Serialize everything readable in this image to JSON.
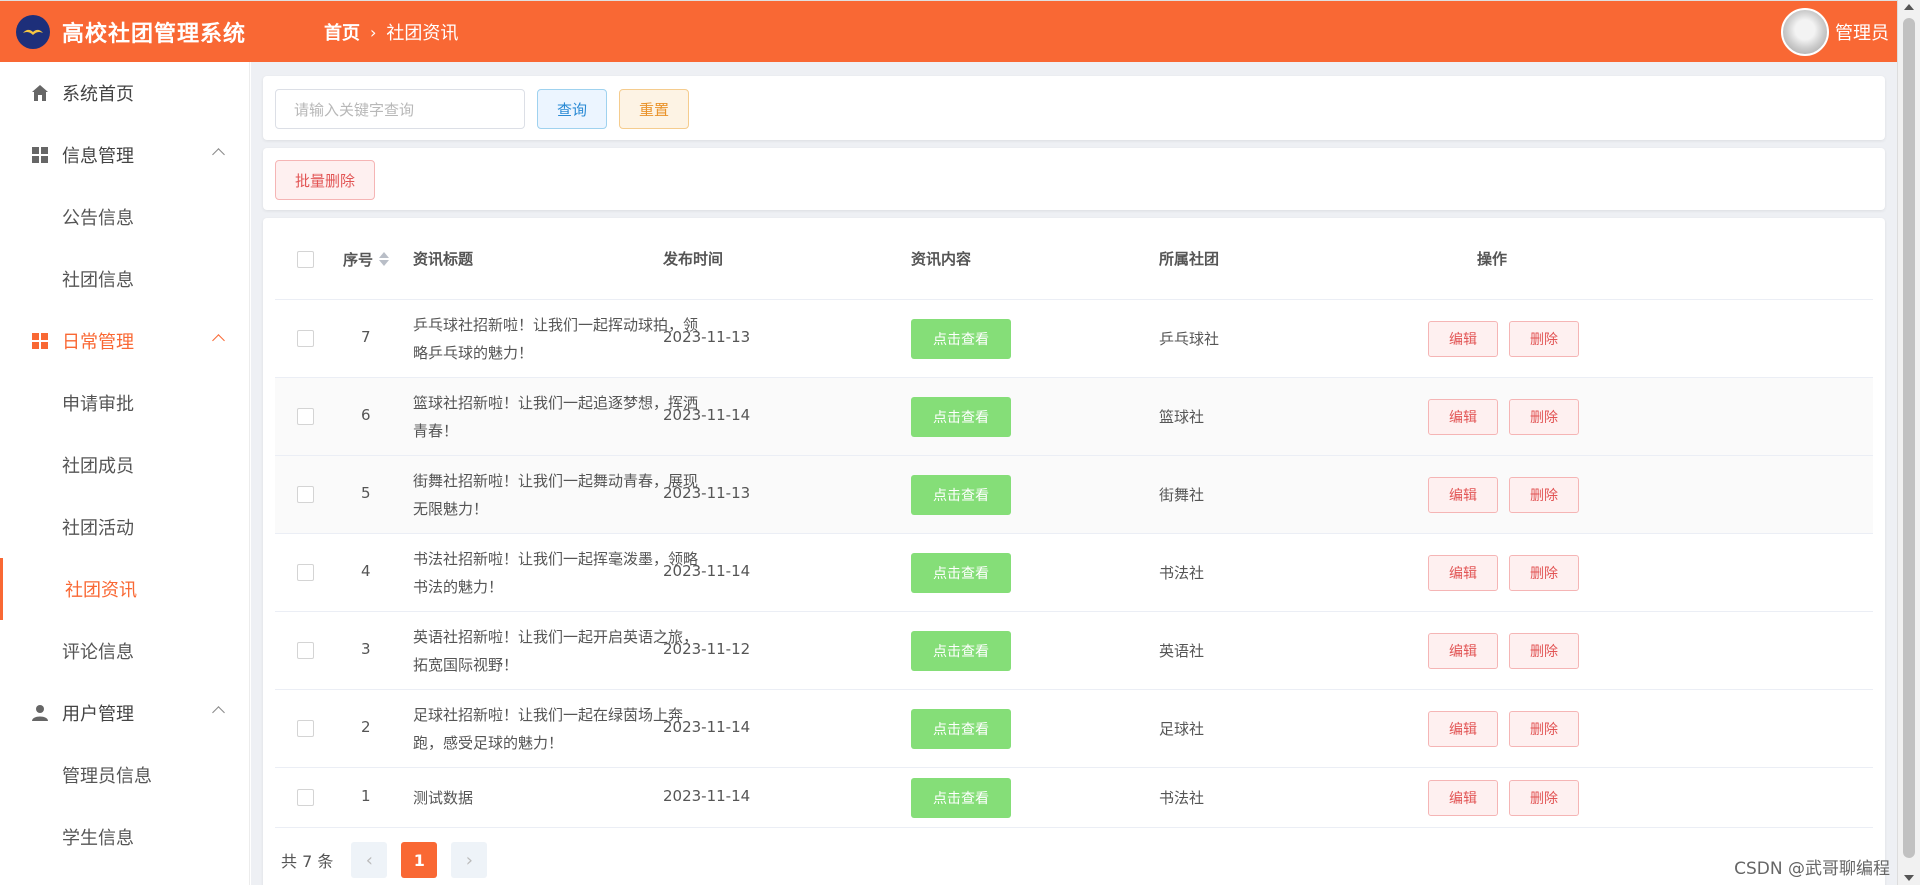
{
  "app": {
    "title": "高校社团管理系统",
    "user": "管理员"
  },
  "breadcrumb": {
    "home": "首页",
    "current": "社团资讯"
  },
  "sidebar": {
    "home": "系统首页",
    "info_group": "信息管理",
    "info_items": [
      "公告信息",
      "社团信息"
    ],
    "daily_group": "日常管理",
    "daily_items": [
      "申请审批",
      "社团成员",
      "社团活动",
      "社团资讯",
      "评论信息"
    ],
    "user_group": "用户管理",
    "user_items": [
      "管理员信息",
      "学生信息"
    ]
  },
  "search": {
    "placeholder": "请输入关键字查询",
    "query_label": "查询",
    "reset_label": "重置"
  },
  "toolbar": {
    "batch_delete_label": "批量删除"
  },
  "table": {
    "headers": {
      "index": "序号",
      "title": "资讯标题",
      "time": "发布时间",
      "content": "资讯内容",
      "club": "所属社团",
      "action": "操作"
    },
    "view_label": "点击查看",
    "edit_label": "编辑",
    "delete_label": "删除",
    "rows": [
      {
        "id": "7",
        "title": "乒乓球社招新啦！让我们一起挥动球拍，领略乒乓球的魅力！",
        "time": "2023-11-13",
        "club": "乒乓球社"
      },
      {
        "id": "6",
        "title": "篮球社招新啦！让我们一起追逐梦想，挥洒青春！",
        "time": "2023-11-14",
        "club": "篮球社"
      },
      {
        "id": "5",
        "title": "街舞社招新啦！让我们一起舞动青春，展现无限魅力！",
        "time": "2023-11-13",
        "club": "街舞社"
      },
      {
        "id": "4",
        "title": "书法社招新啦！让我们一起挥毫泼墨，领略书法的魅力！",
        "time": "2023-11-14",
        "club": "书法社"
      },
      {
        "id": "3",
        "title": "英语社招新啦！让我们一起开启英语之旅，拓宽国际视野！",
        "time": "2023-11-12",
        "club": "英语社"
      },
      {
        "id": "2",
        "title": "足球社招新啦！让我们一起在绿茵场上奔跑，感受足球的魅力！",
        "time": "2023-11-14",
        "club": "足球社"
      },
      {
        "id": "1",
        "title": "测试数据",
        "time": "2023-11-14",
        "club": "书法社"
      }
    ]
  },
  "pagination": {
    "total_label": "共 7 条",
    "current_page": "1"
  },
  "watermark": "CSDN @武哥聊编程",
  "colors": {
    "primary": "#f96834",
    "view_button": "#85de78",
    "danger": "#e25555"
  }
}
